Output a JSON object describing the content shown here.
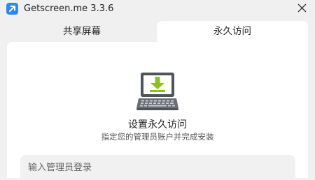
{
  "window": {
    "title": "Getscreen.me 3.3.6"
  },
  "tabs": [
    {
      "label": "共享屏幕",
      "active": false
    },
    {
      "label": "永久访问",
      "active": true
    }
  ],
  "main": {
    "icon": "laptop-download-icon",
    "heading": "设置永久访问",
    "description": "指定您的管理员账户并完成安装",
    "admin_login": {
      "value": "",
      "placeholder": "输入管理员登录"
    }
  },
  "colors": {
    "accent_blue": "#2f86f6",
    "download_green": "#8cc21f",
    "laptop_gray": "#5b5f66",
    "panel_bg": "#ffffff",
    "window_bg": "#f0f0f0"
  }
}
